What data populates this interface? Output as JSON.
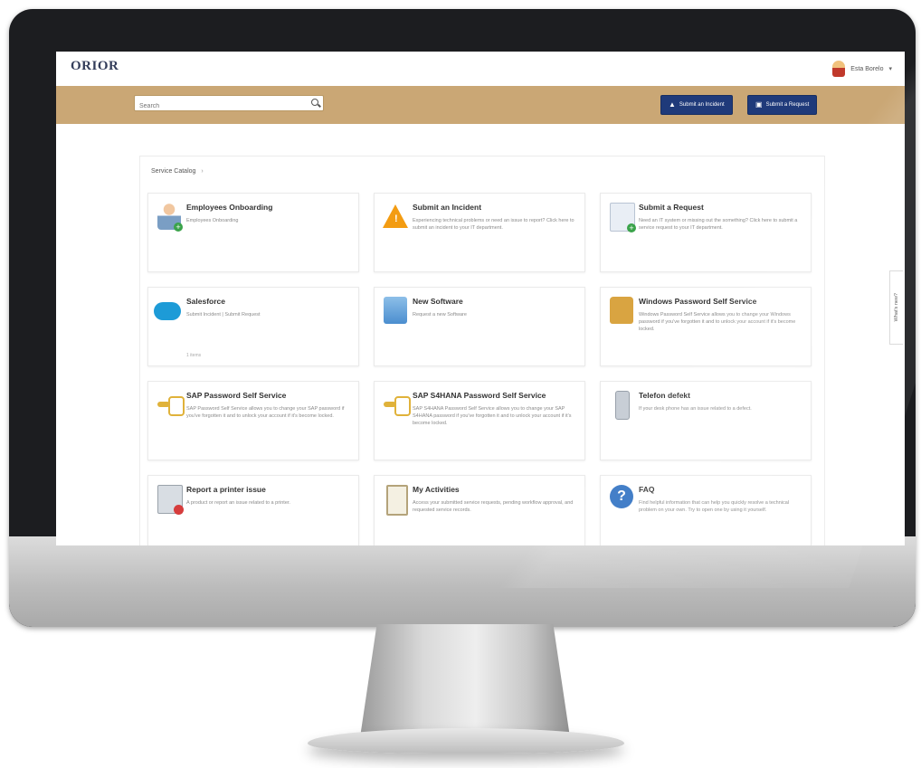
{
  "header": {
    "logo": "ORIOR",
    "logo_sub": "",
    "user_name": "Esta Borelo"
  },
  "search": {
    "placeholder": "Search"
  },
  "actions": {
    "incident_label": "Submit an Incident",
    "request_label": "Submit a Request"
  },
  "breadcrumb": {
    "label": "Service Catalog"
  },
  "side_tab": {
    "label": "What's new?"
  },
  "cards": [
    {
      "title": "Employees Onboarding",
      "desc": "Employees Onboarding",
      "foot": "",
      "icon": "person-add-icon"
    },
    {
      "title": "Submit an Incident",
      "desc": "Experiencing technical problems or need an issue to report? Click here to submit an incident to your IT department.",
      "foot": "",
      "icon": "warning-icon"
    },
    {
      "title": "Submit a Request",
      "desc": "Need an IT system or missing out the something? Click here to submit a service request to your IT department.",
      "foot": "",
      "icon": "document-icon"
    },
    {
      "title": "Salesforce",
      "desc": "Submit Incident | Submit Request",
      "foot": "1 items",
      "icon": "salesforce-cloud-icon"
    },
    {
      "title": "New Software",
      "desc": "Request a new Software",
      "foot": "",
      "icon": "software-box-icon"
    },
    {
      "title": "Windows Password Self Service",
      "desc": "Windows Password Self Service allows you to change your Windows password if you've forgotten it and to unlock your account if it's become locked.",
      "foot": "",
      "icon": "lock-user-icon"
    },
    {
      "title": "SAP Password Self Service",
      "desc": "SAP Password Self Service allows you to change your SAP password if you've forgotten it and to unlock your account if it's become locked.",
      "foot": "",
      "icon": "key-lock-icon"
    },
    {
      "title": "SAP S4HANA Password Self Service",
      "desc": "SAP S4HANA Password Self Service allows you to change your SAP S4HANA password if you've forgotten it and to unlock your account if it's become locked.",
      "foot": "",
      "icon": "key-lock-icon"
    },
    {
      "title": "Telefon defekt",
      "desc": "If your desk phone has an issue related to a defect.",
      "foot": "",
      "icon": "phone-icon"
    },
    {
      "title": "Report a printer issue",
      "desc": "A product or report an issue related to a printer.",
      "foot": "",
      "icon": "printer-icon"
    },
    {
      "title": "My Activities",
      "desc": "Access your submitted service requests, pending workflow approval, and requested service records.",
      "foot": "",
      "icon": "clipboard-icon"
    },
    {
      "title": "FAQ",
      "desc": "Find helpful information that can help you quickly resolve a technical problem on your own. Try to open one by using it yourself.",
      "foot": "",
      "icon": "help-icon"
    }
  ]
}
